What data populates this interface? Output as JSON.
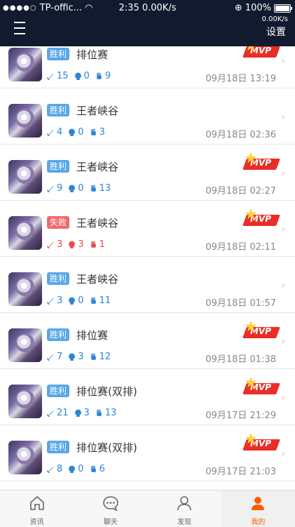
{
  "status": {
    "carrier": "TP-offic...",
    "time": "2:35",
    "speed": "0.00K/s",
    "battery": "100%"
  },
  "header": {
    "speed": "0.00K/s",
    "settings_label": "设置"
  },
  "matches": [
    {
      "result": "胜利",
      "result_type": "win",
      "mode": "排位赛",
      "kills": "15",
      "deaths": "0",
      "assists": "9",
      "time": "09月18日 13:19",
      "mvp": true
    },
    {
      "result": "胜利",
      "result_type": "win",
      "mode": "王者峡谷",
      "kills": "4",
      "deaths": "0",
      "assists": "3",
      "time": "09月18日 02:36",
      "mvp": false
    },
    {
      "result": "胜利",
      "result_type": "win",
      "mode": "王者峡谷",
      "kills": "9",
      "deaths": "0",
      "assists": "13",
      "time": "09月18日 02:27",
      "mvp": true
    },
    {
      "result": "失败",
      "result_type": "lose",
      "mode": "王者峡谷",
      "kills": "3",
      "deaths": "3",
      "assists": "1",
      "time": "09月18日 02:11",
      "mvp": true
    },
    {
      "result": "胜利",
      "result_type": "win",
      "mode": "王者峡谷",
      "kills": "3",
      "deaths": "0",
      "assists": "11",
      "time": "09月18日 01:57",
      "mvp": false
    },
    {
      "result": "胜利",
      "result_type": "win",
      "mode": "排位赛",
      "kills": "7",
      "deaths": "3",
      "assists": "12",
      "time": "09月18日 01:38",
      "mvp": true
    },
    {
      "result": "胜利",
      "result_type": "win",
      "mode": "排位赛(双排)",
      "kills": "21",
      "deaths": "3",
      "assists": "13",
      "time": "09月17日 21:29",
      "mvp": true
    },
    {
      "result": "胜利",
      "result_type": "win",
      "mode": "排位赛(双排)",
      "kills": "8",
      "deaths": "0",
      "assists": "6",
      "time": "09月17日 21:03",
      "mvp": true
    }
  ],
  "mvp_label": "MVP",
  "tabs": [
    {
      "label": "资讯",
      "icon": "home-icon",
      "active": false
    },
    {
      "label": "聊天",
      "icon": "chat-icon",
      "active": false
    },
    {
      "label": "发现",
      "icon": "discover-icon",
      "active": false
    },
    {
      "label": "我的",
      "icon": "profile-icon",
      "active": true
    }
  ],
  "colors": {
    "header_bg": "#111a2e",
    "win_tag": "#5aa7e6",
    "lose_tag": "#f06a6a",
    "mvp_red": "#ea2d26",
    "active_tab": "#ff5a00"
  }
}
